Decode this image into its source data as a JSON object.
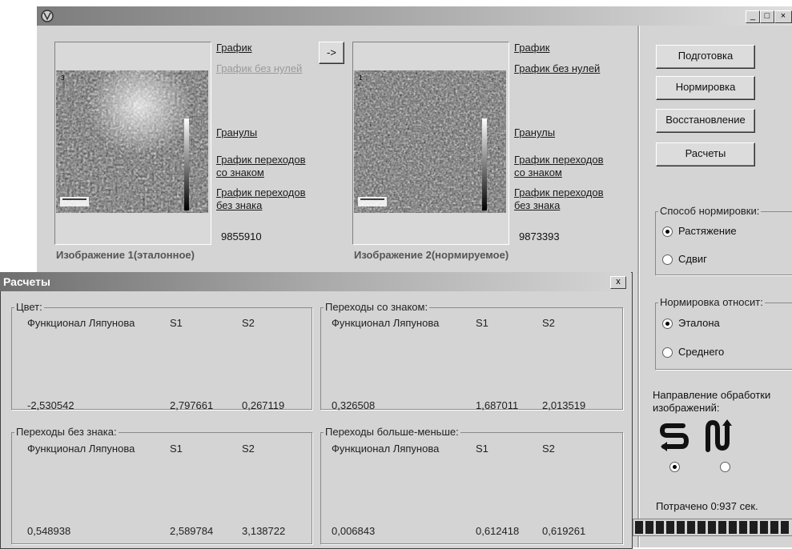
{
  "window": {
    "min_label": "_",
    "max_label": "□",
    "close_label": "×"
  },
  "panel1": {
    "links": [
      "График",
      "График без нулей",
      "Гранулы",
      "График переходов со знаком",
      "График переходов без знака"
    ],
    "value": "9855910",
    "caption": "Изображение 1(эталонное)"
  },
  "transfer_button": "->",
  "panel2": {
    "links": [
      "График",
      "График без нулей",
      "Гранулы",
      "График переходов со знаком",
      "График переходов без знака"
    ],
    "value": "9873393",
    "caption": "Изображение 2(нормируемое)"
  },
  "buttons": [
    "Подготовка",
    "Нормировка",
    "Восстановление",
    "Расчеты"
  ],
  "norm_method": {
    "title": "Способ нормировки:",
    "options": [
      "Растяжение",
      "Сдвиг"
    ],
    "selected": 0
  },
  "norm_relative": {
    "title": "Нормировка относит:",
    "options": [
      "Эталона",
      "Среднего"
    ],
    "selected": 0
  },
  "direction": {
    "title": "Направление обработки изображений:",
    "selected": 0
  },
  "spent_label": "Потрачено 0:937 сек.",
  "progress": 1.0,
  "dialog": {
    "title": "Расчеты",
    "close_label": "x",
    "groups": [
      {
        "title": "Цвет:",
        "h1": "Функционал Ляпунова",
        "h2": "S1",
        "h3": "S2",
        "v1": "-2,530542",
        "v2": "2,797661",
        "v3": "0,267119"
      },
      {
        "title": "Переходы со знаком:",
        "h1": "Функционал Ляпунова",
        "h2": "S1",
        "h3": "S2",
        "v1": "0,326508",
        "v2": "1,687011",
        "v3": "2,013519"
      },
      {
        "title": "Переходы без знака:",
        "h1": "Функционал Ляпунова",
        "h2": "S1",
        "h3": "S2",
        "v1": "0,548938",
        "v2": "2,589784",
        "v3": "3,138722"
      },
      {
        "title": "Переходы больше-меньше:",
        "h1": "Функционал Ляпунова",
        "h2": "S1",
        "h3": "S2",
        "v1": "0,006843",
        "v2": "0,612418",
        "v3": "0,619261"
      }
    ]
  },
  "icons": [
    "app-icon",
    "s-shape-direction-icon",
    "u-shape-direction-icon",
    "color-scale-bar"
  ]
}
